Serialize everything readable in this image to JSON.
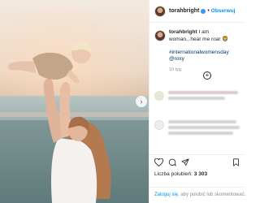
{
  "post": {
    "author": "torahbright",
    "follow_label": "Obserwuj",
    "separator": "•",
    "caption_text": "I am woman...hear me roar 🦁",
    "hashtags": "#internationalwomensday @roxy",
    "time_ago": "10 tyg.",
    "load_more_symbol": "+",
    "likes_label": "Liczba polubień:",
    "likes_count": "3 303",
    "login_link": "Zaloguj się",
    "login_rest": ", aby polubić lub skomentować."
  },
  "icons": {
    "next": "chevron-right-icon",
    "like": "heart-icon",
    "comment": "comment-icon",
    "share": "paper-plane-icon",
    "save": "bookmark-icon"
  },
  "colors": {
    "accent": "#0095f6",
    "hashtag": "#00376b",
    "muted": "#8e8e8e",
    "text": "#262626"
  }
}
